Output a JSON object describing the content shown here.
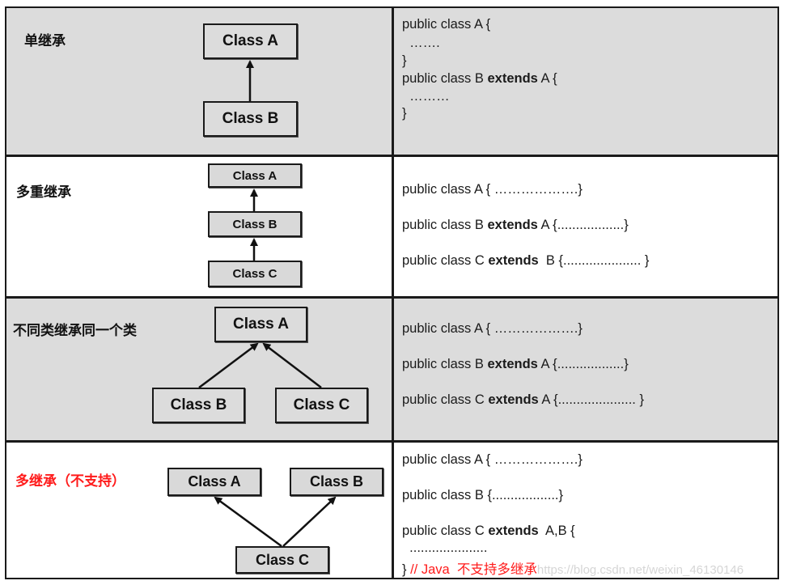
{
  "rows": [
    {
      "label": "单继承",
      "label_color": "#111111",
      "classes": [
        "Class A",
        "Class B"
      ],
      "code": {
        "line1": "public class A {",
        "line2": "  …….",
        "line3": "}",
        "line4_pre": "public class B ",
        "line4_kw": "extends",
        "line4_post": " A {",
        "line5": "  ………",
        "line6": "}"
      }
    },
    {
      "label": "多重继承",
      "label_color": "#111111",
      "classes": [
        "Class A",
        "Class B",
        "Class C"
      ],
      "code": {
        "line1": "public class A { ……………….}",
        "line2_pre": "public class B ",
        "line2_kw": "extends",
        "line2_post": " A {..................}",
        "line3_pre": "public class C ",
        "line3_kw": "extends",
        "line3_post": "  B {..................... }"
      }
    },
    {
      "label": "不同类继承同一个类",
      "label_color": "#111111",
      "classes": [
        "Class A",
        "Class B",
        "Class C"
      ],
      "code": {
        "line1": "public class A { ……………….}",
        "line2_pre": "public class B ",
        "line2_kw": "extends",
        "line2_post": " A {..................}",
        "line3_pre": "public class C ",
        "line3_kw": "extends",
        "line3_post": " A {..................... }"
      }
    },
    {
      "label": "多继承（不支持）",
      "label_color": "#ff1a1a",
      "classes": [
        "Class A",
        "Class B",
        "Class C"
      ],
      "code": {
        "line1": "public class A { ……………….}",
        "line2": "public class B {..................}",
        "line3_pre": "public class C ",
        "line3_kw": "extends",
        "line3_post": "  A,B {",
        "line4": "  .....................",
        "line5_brace": "}",
        "line5_comment": " // Java  不支持多继承",
        "watermark": "https://blog.csdn.net/weixin_46130146"
      }
    }
  ],
  "colors": {
    "border": "#1a1a1a",
    "gray_row": "#dcdcdc",
    "box_fill": "#d9d9d9",
    "accent_red": "#ff1a1a"
  }
}
